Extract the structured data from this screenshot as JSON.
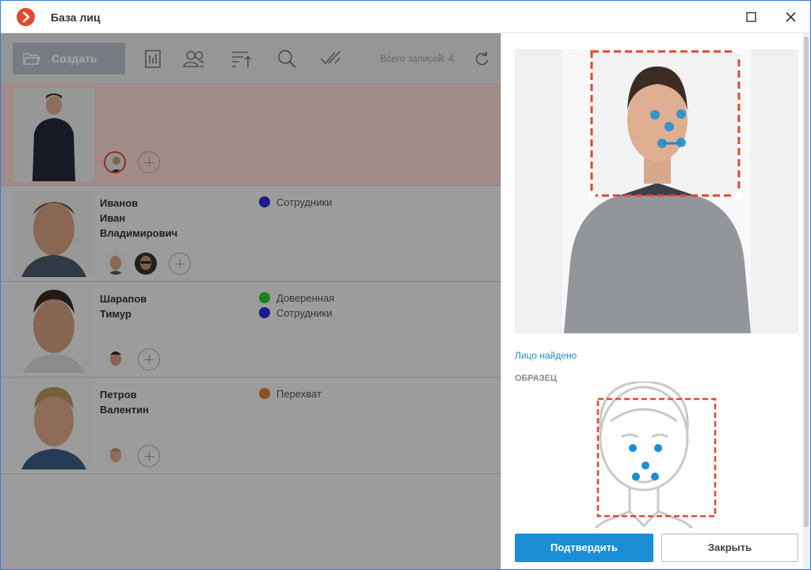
{
  "window": {
    "title": "База лиц"
  },
  "toolbar": {
    "create_label": "Создать",
    "total_records": "Всего записей: 4"
  },
  "persons": [
    {
      "name_lines": [
        "",
        "",
        ""
      ],
      "groups": [],
      "selected": true
    },
    {
      "name_lines": [
        "Иванов",
        "Иван",
        "Владимирович"
      ],
      "groups": [
        {
          "label": "Сотрудники",
          "color": "#2b2bd6"
        }
      ]
    },
    {
      "name_lines": [
        "Шарапов",
        "Тимур",
        ""
      ],
      "groups": [
        {
          "label": "Доверенная",
          "color": "#28c828"
        },
        {
          "label": "Сотрудники",
          "color": "#2b2bd6"
        }
      ]
    },
    {
      "name_lines": [
        "Петров",
        "Валентин",
        ""
      ],
      "groups": [
        {
          "label": "Перехват",
          "color": "#e07a2e"
        }
      ]
    }
  ],
  "panel": {
    "status": "Лицо найдено",
    "sample_title": "ОБРАЗЕЦ",
    "confirm_label": "Подтвердить",
    "close_label": "Закрыть"
  },
  "colors": {
    "accent": "#1a8ed6",
    "brand": "#e4472c",
    "face_frame": "#e4472c",
    "landmark": "#1a8ed6"
  }
}
